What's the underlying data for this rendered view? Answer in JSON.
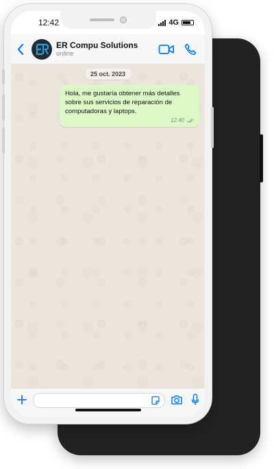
{
  "status_bar": {
    "time": "12:42",
    "network": "4G"
  },
  "header": {
    "contact_name": "ER Compu Solutions",
    "contact_status": "online"
  },
  "chat": {
    "date": "25 oct. 2023",
    "messages": [
      {
        "text": "Hola, me gustaría obtener más detalles sobre sus servicios de reparación de computadoras y laptops.",
        "time": "12:40",
        "status": "delivered"
      }
    ]
  },
  "composer": {
    "placeholder": ""
  },
  "colors": {
    "accent": "#007aff",
    "bubble_outgoing": "#dcf8c6",
    "chat_background": "#ece5dd",
    "avatar_bg": "#1f2a33",
    "avatar_logo": "#2f9bd6"
  },
  "icons": [
    "back-icon",
    "video-call-icon",
    "phone-call-icon",
    "plus-icon",
    "sticker-icon",
    "camera-icon",
    "microphone-icon",
    "double-check-icon"
  ]
}
